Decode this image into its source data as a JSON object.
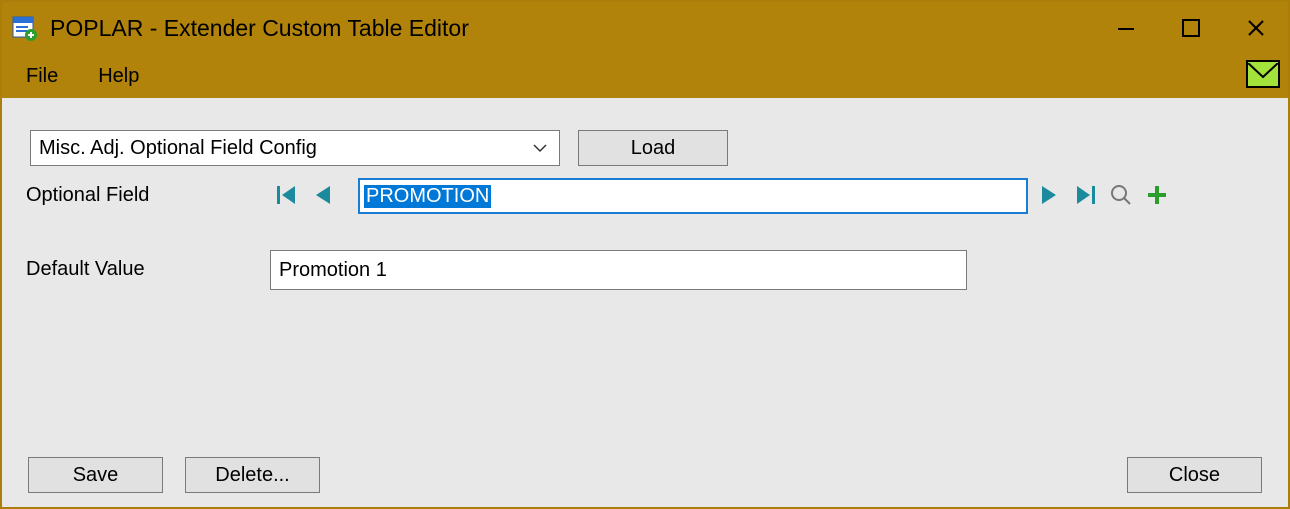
{
  "window": {
    "title": "POPLAR - Extender Custom Table Editor"
  },
  "menu": {
    "file": "File",
    "help": "Help"
  },
  "selector": {
    "value": "Misc. Adj. Optional Field Config",
    "load_label": "Load"
  },
  "fields": {
    "optional_label": "Optional Field",
    "optional_value": "PROMOTION",
    "default_label": "Default Value",
    "default_value": "Promotion 1"
  },
  "footer": {
    "save": "Save",
    "delete": "Delete...",
    "close": "Close"
  },
  "colors": {
    "chrome": "#b1830b",
    "accent": "#0078d7",
    "nav_teal": "#1b8a9c",
    "add_green": "#2a9d2a"
  }
}
